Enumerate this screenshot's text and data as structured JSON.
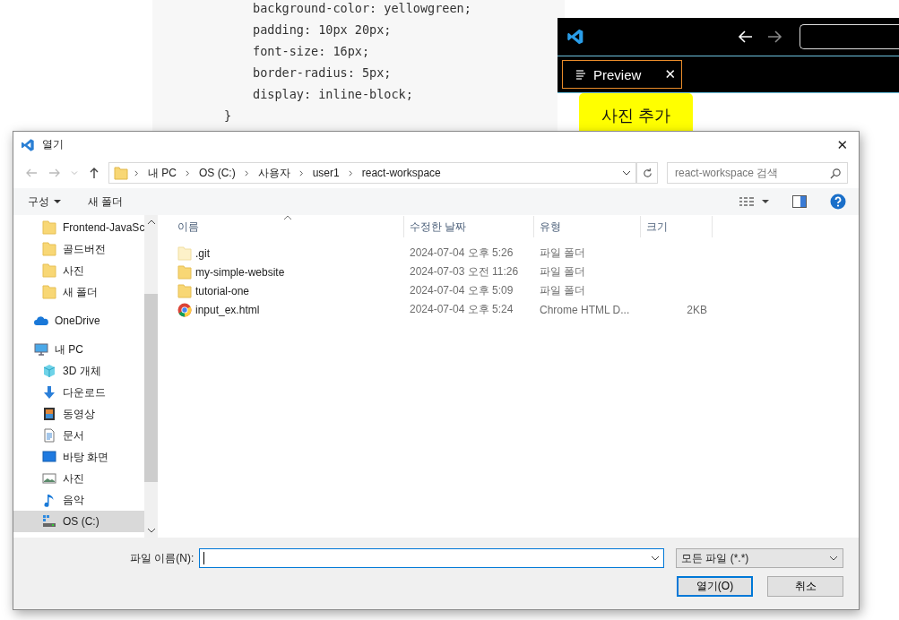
{
  "code_lines": [
    {
      "kind": "property",
      "text": "background-color: yellowgreen;"
    },
    {
      "kind": "property",
      "text": "padding: 10px 20px;"
    },
    {
      "kind": "property",
      "text": "font-size: 16px;"
    },
    {
      "kind": "property",
      "text": "border-radius: 5px;"
    },
    {
      "kind": "property",
      "text": "display: inline-block;"
    },
    {
      "kind": "brace",
      "text": "}"
    }
  ],
  "preview_window": {
    "tab": {
      "label": "Preview",
      "selected": true,
      "close": "✕"
    },
    "button": "사진 추가"
  },
  "dialog": {
    "title": "열기",
    "close": "✕",
    "breadcrumb": [
      "내 PC",
      "OS (C:)",
      "사용자",
      "user1",
      "react-workspace"
    ],
    "search": {
      "placeholder": "react-workspace 검색"
    },
    "commands": [
      {
        "label": "구성",
        "dropdown": true
      },
      {
        "label": "새 폴더",
        "dropdown": false
      }
    ],
    "nav_items": [
      {
        "kind": "folder",
        "label": "Frontend-JavaSc",
        "selected": false
      },
      {
        "kind": "folder",
        "label": "골드버전",
        "selected": false
      },
      {
        "kind": "folder",
        "label": "사진",
        "selected": false
      },
      {
        "kind": "folder",
        "label": "새 폴더",
        "selected": false
      },
      {
        "kind": "cloud",
        "label": "OneDrive",
        "selected": false
      },
      {
        "kind": "pc",
        "label": "내 PC",
        "selected": false,
        "children": [
          {
            "kind": "cube",
            "label": "3D 개체",
            "selected": false
          },
          {
            "kind": "download",
            "label": "다운로드",
            "selected": false
          },
          {
            "kind": "video",
            "label": "동영상",
            "selected": false
          },
          {
            "kind": "document",
            "label": "문서",
            "selected": false
          },
          {
            "kind": "desktop",
            "label": "바탕 화면",
            "selected": false
          },
          {
            "kind": "image",
            "label": "사진",
            "selected": false
          },
          {
            "kind": "music",
            "label": "음악",
            "selected": false
          },
          {
            "kind": "drive",
            "label": "OS (C:)",
            "selected": true
          }
        ]
      }
    ],
    "table": {
      "columns": [
        "이름",
        "수정한 날짜",
        "유형",
        "크기"
      ],
      "rows": [
        {
          "kind": "folder-faded",
          "name": ".git",
          "modified": "2024-07-04 오후 5:26",
          "type": "파일 폴더",
          "selected": false
        },
        {
          "kind": "folder",
          "name": "my-simple-website",
          "modified": "2024-07-03 오전 11:26",
          "type": "파일 폴더",
          "selected": false
        },
        {
          "kind": "folder",
          "name": "tutorial-one",
          "modified": "2024-07-04 오후 5:09",
          "type": "파일 폴더",
          "selected": false
        },
        {
          "kind": "chrome",
          "name": "input_ex.html",
          "modified": "2024-07-04 오후 5:24",
          "type": "Chrome HTML D...",
          "size": "2KB",
          "selected": false
        }
      ]
    },
    "file_name_label": "파일 이름(N):",
    "file_type": "모든 파일 (*.*)",
    "buttons": [
      {
        "label": "열기(O)",
        "default": true
      },
      {
        "label": "취소",
        "default": false
      }
    ]
  }
}
